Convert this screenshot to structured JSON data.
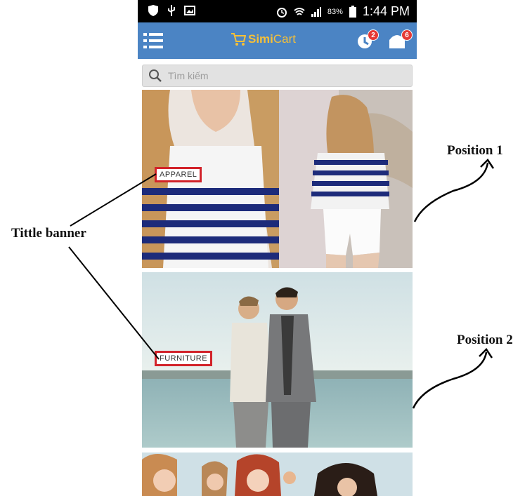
{
  "status_bar": {
    "battery_percent": "83%",
    "time": "1:44 PM"
  },
  "app_bar": {
    "logo_simi": "Simi",
    "logo_cart": "Cart",
    "notification_count": "2",
    "cart_count": "6"
  },
  "search": {
    "placeholder": "Tìm kiếm"
  },
  "banners": [
    {
      "title": "APPAREL"
    },
    {
      "title": "FURNITURE"
    }
  ],
  "annotations": {
    "title_banner": "Tittle banner",
    "position_1": "Position 1",
    "position_2": "Position 2"
  },
  "colors": {
    "app_bar": "#4b84c4",
    "logo": "#f6c038",
    "badge": "#e53935",
    "tag_border": "#d2232a"
  }
}
